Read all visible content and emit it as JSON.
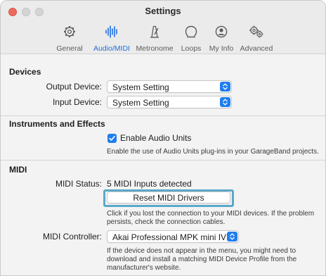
{
  "window": {
    "title": "Settings"
  },
  "tabs": [
    {
      "label": "General",
      "icon": "gear-icon"
    },
    {
      "label": "Audio/MIDI",
      "icon": "audio-waveform-icon",
      "active": true
    },
    {
      "label": "Metronome",
      "icon": "metronome-icon"
    },
    {
      "label": "Loops",
      "icon": "loops-icon"
    },
    {
      "label": "My Info",
      "icon": "person-icon"
    },
    {
      "label": "Advanced",
      "icon": "gears-icon"
    }
  ],
  "devices": {
    "title": "Devices",
    "output_label": "Output Device:",
    "output_value": "System Setting",
    "input_label": "Input Device:",
    "input_value": "System Setting"
  },
  "instruments": {
    "title": "Instruments and Effects",
    "checkbox_label": "Enable Audio Units",
    "checkbox_checked": true,
    "help": "Enable the use of Audio Units plug-ins in your GarageBand projects."
  },
  "midi": {
    "title": "MIDI",
    "status_label": "MIDI Status:",
    "status_value": "5 MIDI Inputs detected",
    "reset_button": "Reset MIDI Drivers",
    "reset_help": "Click if you lost the connection to your MIDI devices. If the problem persists, check the connection cables.",
    "controller_label": "MIDI Controller:",
    "controller_value": "Akai Professional MPK mini IV",
    "controller_help": "If the device does not appear in the menu, you might need to download and install a matching MIDI Device Profile from the manufacturer's website."
  },
  "colors": {
    "accent": "#1f7ef0",
    "active_tab": "#1f6fe0",
    "highlight": "#5aa9c9",
    "close_button": "#ed6a5e"
  }
}
